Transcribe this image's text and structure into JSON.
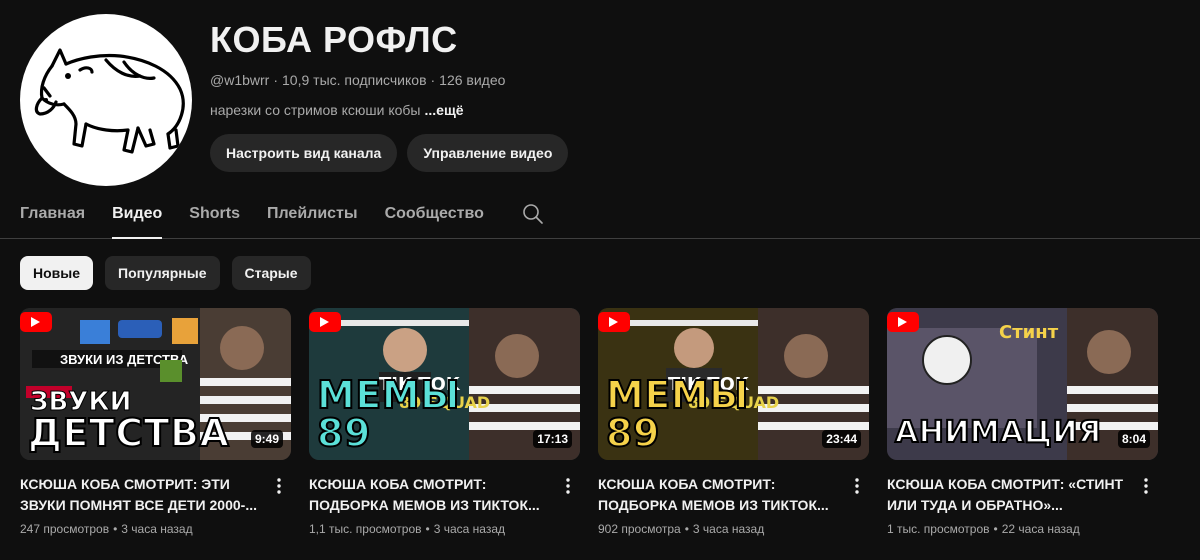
{
  "channel": {
    "title": "КОБА РОФЛС",
    "handle": "@w1bwrr",
    "subscribers": "10,9 тыс. подписчиков",
    "video_count": "126 видео",
    "meta_separator": "·",
    "description": "нарезки со стримов ксюши кобы",
    "more_label": "...ещё",
    "actions": {
      "customize_label": "Настроить вид канала",
      "manage_label": "Управление видео"
    }
  },
  "tabs": [
    {
      "label": "Главная",
      "active": false
    },
    {
      "label": "Видео",
      "active": true
    },
    {
      "label": "Shorts",
      "active": false
    },
    {
      "label": "Плейлисты",
      "active": false
    },
    {
      "label": "Сообщество",
      "active": false
    }
  ],
  "chips": [
    {
      "label": "Новые",
      "active": true
    },
    {
      "label": "Популярные",
      "active": false
    },
    {
      "label": "Старые",
      "active": false
    }
  ],
  "videos": [
    {
      "title": "КСЮША КОБА СМОТРИТ: ЭТИ ЗВУКИ ПОМНЯТ ВСЕ ДЕТИ 2000-...",
      "views": "247 просмотров",
      "age": "3 часа назад",
      "duration": "9:49",
      "thumb_caption": "ДЕТСТВА",
      "thumb_caption_color": "#ffffff",
      "thumb_bg": "#2a2a2a"
    },
    {
      "title": "КСЮША КОБА СМОТРИТ: ПОДБОРКА МЕМОВ ИЗ ТИКТОК...",
      "views": "1,1 тыс. просмотров",
      "age": "3 часа назад",
      "duration": "17:13",
      "thumb_caption": "МЕМЫ 89",
      "thumb_caption_color": "#5be0d8",
      "thumb_bg": "#1e3a3c"
    },
    {
      "title": "КСЮША КОБА СМОТРИТ: ПОДБОРКА МЕМОВ ИЗ ТИКТОК...",
      "views": "902 просмотра",
      "age": "3 часа назад",
      "duration": "23:44",
      "thumb_caption": "МЕМЫ 89",
      "thumb_caption_color": "#f5d24a",
      "thumb_bg": "#3a3212"
    },
    {
      "title": "КСЮША КОБА СМОТРИТ: «СТИНТ ИЛИ ТУДА И ОБРАТНО»...",
      "views": "1 тыс. просмотров",
      "age": "22 часа назад",
      "duration": "8:04",
      "thumb_caption": "АНИМАЦИЯ",
      "thumb_caption_color": "#ffffff",
      "thumb_bg": "#3d3a4a"
    }
  ],
  "colors": {
    "background": "#0f0f0f",
    "surface": "#272727",
    "text_primary": "#f1f1f1",
    "text_secondary": "#aaaaaa",
    "youtube_red": "#ff0000"
  },
  "icons": {
    "avatar": "boar-drawing",
    "tab_search": "search-icon",
    "video_menu": "kebab-menu-icon",
    "thumb_badge": "youtube-play-icon"
  }
}
